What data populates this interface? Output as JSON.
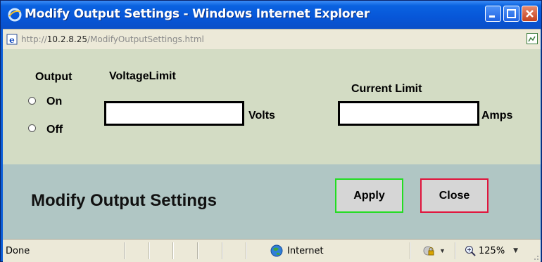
{
  "window": {
    "title": "Modify Output Settings - Windows Internet Explorer"
  },
  "address": {
    "prefix": "http://",
    "host": "10.2.8.25",
    "path": "/ModifyOutputSettings.html"
  },
  "form": {
    "output_label": "Output",
    "on_label": "On",
    "off_label": "Off",
    "voltage_label": "VoltageLimit",
    "voltage_value": "",
    "voltage_unit": "Volts",
    "current_label": "Current Limit",
    "current_value": "",
    "current_unit": "Amps"
  },
  "actions": {
    "heading": "Modify Output Settings",
    "apply_label": "Apply",
    "close_label": "Close"
  },
  "status": {
    "text": "Done",
    "zone": "Internet",
    "zoom": "125%"
  },
  "colors": {
    "form_bg": "#d3dcc4",
    "actions_bg": "#b0c6c4",
    "apply_border": "#22dd22",
    "close_border": "#e0143c"
  }
}
